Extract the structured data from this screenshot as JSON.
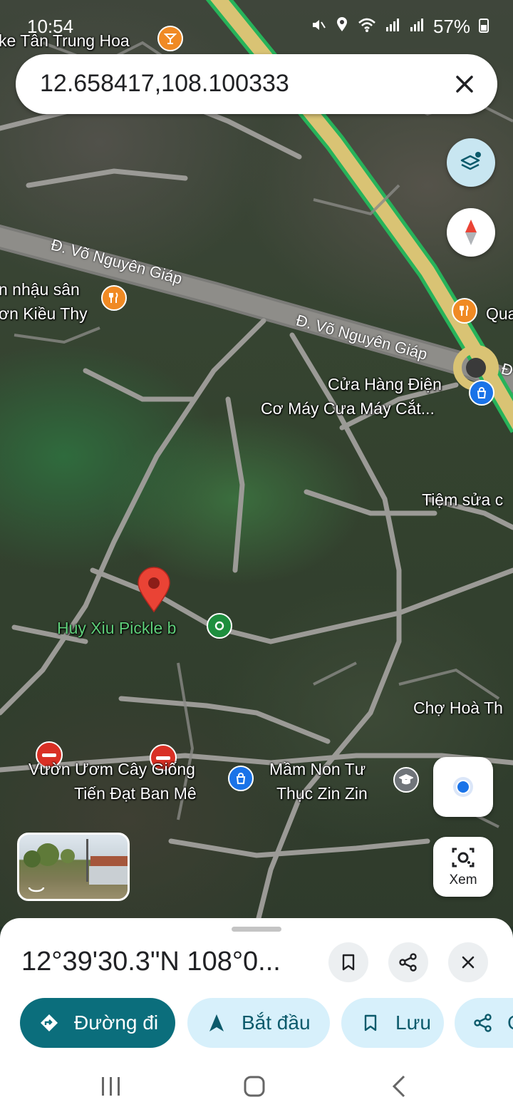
{
  "status_bar": {
    "time": "10:54",
    "battery": "57%"
  },
  "search": {
    "query": "12.658417,108.100333"
  },
  "map": {
    "labels": {
      "cafe_top": "ke Tân Trung Hoa",
      "road_1": "Đ. Võ Nguyên Giáp",
      "road_2": "Đ. Võ Nguyên Giáp",
      "restaurant_left_1": "n nhậu sân",
      "restaurant_left_2": "ơn Kiều Thy",
      "restaurant_right": "Qua",
      "store_1": "Cửa Hàng Điện",
      "store_2": "Cơ Máy Cưa Máy Cắt...",
      "repair": "Tiệm sửa c",
      "pickle": "Huy Xiu Pickle b",
      "market": "Chợ Hoà Th",
      "nursery_1": "Vườn Ươm Cây Giống",
      "nursery_2": "Tiến Đạt Ban Mê",
      "school_1": "Mầm Non Tư",
      "school_2": "Thục Zin Zin",
      "road_edge": "Đ"
    }
  },
  "buttons": {
    "lens_label": "Xem"
  },
  "sheet": {
    "coords_title": "12°39'30.3\"N 108°0...",
    "chips": {
      "directions": "Đường đi",
      "start": "Bắt đầu",
      "save": "Lưu",
      "share": "C"
    }
  },
  "colors": {
    "accent_teal": "#0b6e7c",
    "chip_bg": "#d7f0fb",
    "pin_red": "#ea4335",
    "poi_orange": "#f08a24",
    "poi_blue": "#1a73e8"
  }
}
